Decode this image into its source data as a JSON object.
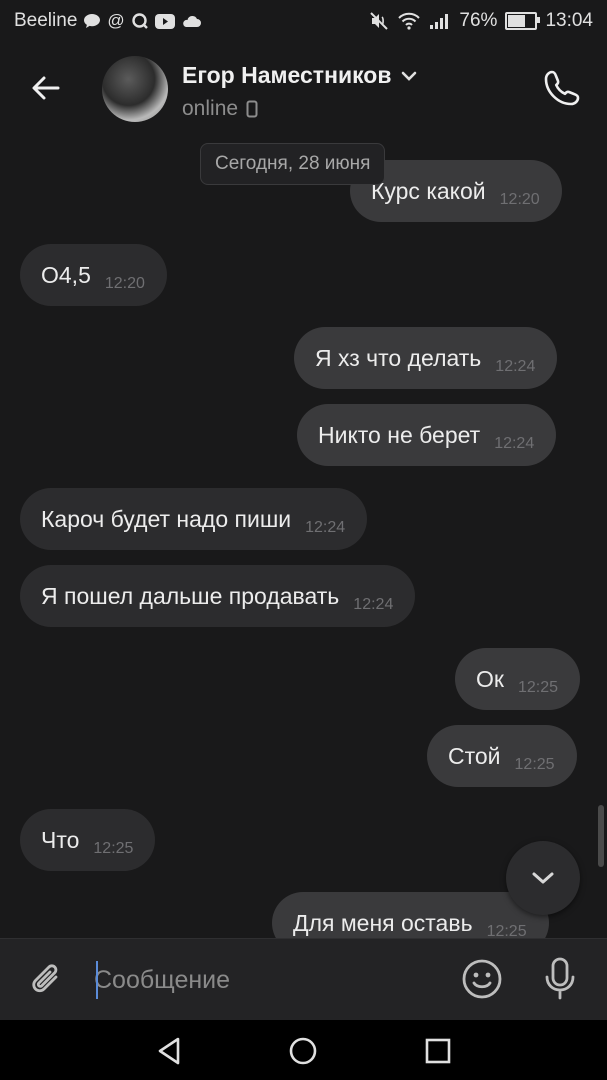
{
  "statusbar": {
    "carrier": "Beeline",
    "battery_percent": "76%",
    "battery_level": 0.76,
    "time": "13:04",
    "icons": [
      "message-icon",
      "at-icon",
      "q-icon",
      "youtube-icon",
      "cloud-icon",
      "mute-icon",
      "wifi-icon",
      "signal-icon",
      "battery-icon"
    ]
  },
  "header": {
    "contact_name": "Егор Наместников",
    "status": "online",
    "icons": [
      "back-arrow-icon",
      "chevron-down-icon",
      "phone-device-icon",
      "call-icon"
    ]
  },
  "chat": {
    "date_label": "Сегодня, 28 июня",
    "messages": [
      {
        "dir": "out",
        "text": "Курс какой",
        "time": "12:20"
      },
      {
        "dir": "in",
        "text": "О4,5",
        "time": "12:20"
      },
      {
        "dir": "out",
        "text": "Я хз что делать",
        "time": "12:24"
      },
      {
        "dir": "out",
        "text": "Никто не берет",
        "time": "12:24"
      },
      {
        "dir": "in",
        "text": "Кароч будет надо пиши",
        "time": "12:24"
      },
      {
        "dir": "in",
        "text": "Я пошел дальше продавать",
        "time": "12:24"
      },
      {
        "dir": "out",
        "text": "Ок",
        "time": "12:25"
      },
      {
        "dir": "out",
        "text": "Стой",
        "time": "12:25"
      },
      {
        "dir": "in",
        "text": "Что",
        "time": "12:25"
      },
      {
        "dir": "out",
        "text": "Для меня оставь",
        "time": "12:25"
      }
    ]
  },
  "composer": {
    "placeholder": "Сообщение",
    "icons": [
      "paperclip-icon",
      "emoji-icon",
      "microphone-icon"
    ]
  },
  "navbar": {
    "icons": [
      "nav-back-icon",
      "nav-home-icon",
      "nav-recents-icon"
    ]
  },
  "colors": {
    "background": "#19191a",
    "bubble_in": "#2c2c2e",
    "bubble_out": "#3a3a3c",
    "caret": "#5b8cd9"
  }
}
